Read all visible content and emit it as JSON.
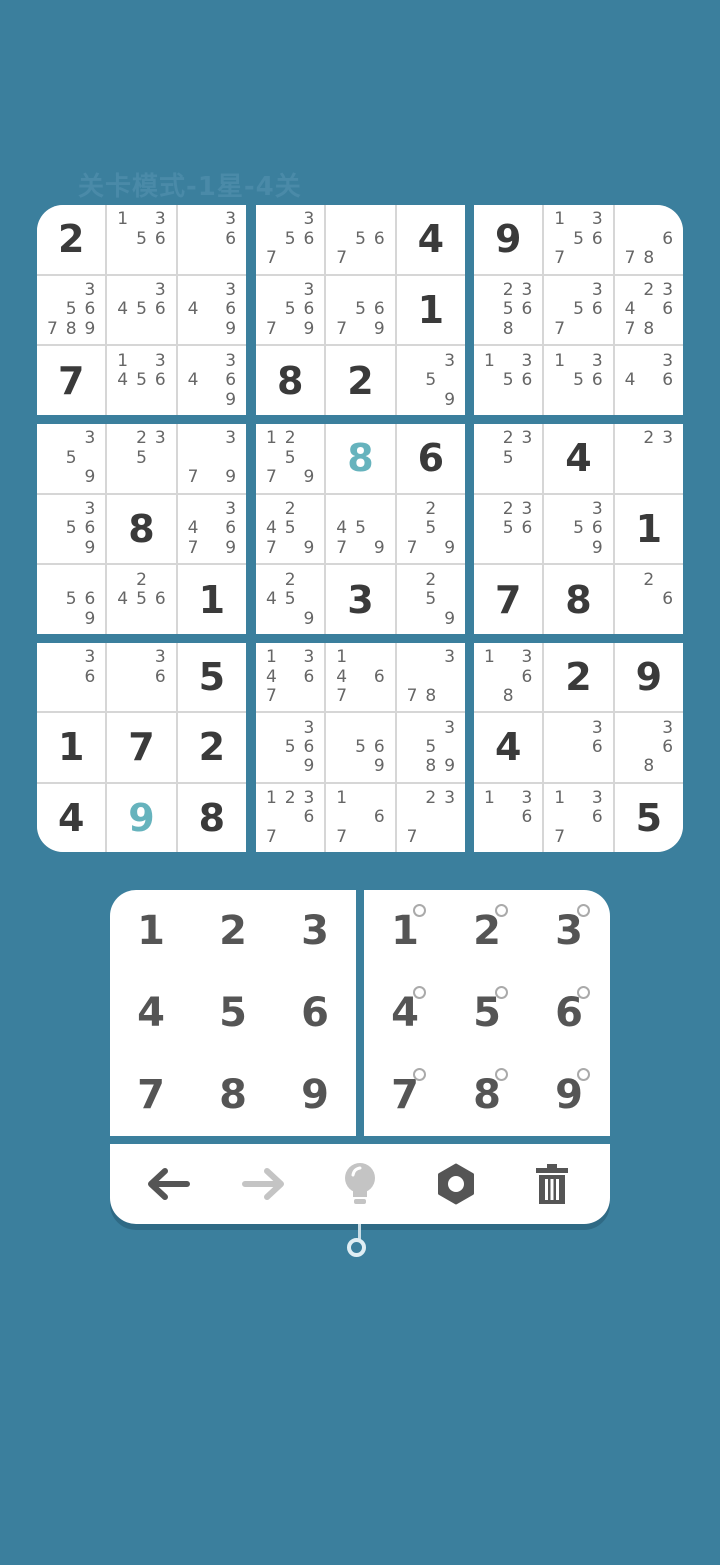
{
  "title": "关卡模式-1星-4关",
  "board": {
    "boxes": [
      [
        {
          "v": "2"
        },
        {
          "n": "1,3,5,6"
        },
        {
          "n": "3,6"
        },
        {
          "n": "3,5,6,7,8,9"
        },
        {
          "n": "3,4,5,6"
        },
        {
          "n": "3,4,6,9"
        },
        {
          "v": "7"
        },
        {
          "n": "1,3,4,5,6"
        },
        {
          "n": "3,4,6,9"
        }
      ],
      [
        {
          "n": "3,5,6,7"
        },
        {
          "n": "5,6,7"
        },
        {
          "v": "4"
        },
        {
          "n": "3,5,6,7,9"
        },
        {
          "n": "5,6,7,9"
        },
        {
          "v": "1"
        },
        {
          "v": "8"
        },
        {
          "v": "2"
        },
        {
          "n": "3,5,9"
        }
      ],
      [
        {
          "v": "9"
        },
        {
          "n": "1,3,5,6,7"
        },
        {
          "n": "6,7,8"
        },
        {
          "n": "2,3,5,6,8"
        },
        {
          "n": "3,5,6,7"
        },
        {
          "n": "2,3,4,6,7,8"
        },
        {
          "n": "1,3,5,6"
        },
        {
          "n": "1,3,5,6"
        },
        {
          "n": "3,4,6"
        }
      ],
      [
        {
          "n": "3,5,9"
        },
        {
          "n": "2,3,5"
        },
        {
          "n": "3,7,9"
        },
        {
          "n": "3,5,6,9"
        },
        {
          "v": "8"
        },
        {
          "n": "3,4,6,7,9"
        },
        {
          "n": "5,6,9"
        },
        {
          "n": "2,4,5,6"
        },
        {
          "v": "1"
        }
      ],
      [
        {
          "n": "1,2,5,7,9"
        },
        {
          "v": "8",
          "hint": true
        },
        {
          "v": "6"
        },
        {
          "n": "2,4,5,7,9"
        },
        {
          "n": "4,5,7,9"
        },
        {
          "n": "2,5,7,9"
        },
        {
          "n": "2,4,5,9"
        },
        {
          "v": "3"
        },
        {
          "n": "2,5,9"
        }
      ],
      [
        {
          "n": "2,3,5"
        },
        {
          "v": "4"
        },
        {
          "n": "2,3"
        },
        {
          "n": "2,3,5,6"
        },
        {
          "n": "3,5,6,9"
        },
        {
          "v": "1"
        },
        {
          "v": "7"
        },
        {
          "v": "8"
        },
        {
          "n": "2,6"
        }
      ],
      [
        {
          "n": "3,6"
        },
        {
          "n": "3,6"
        },
        {
          "v": "5"
        },
        {
          "v": "1"
        },
        {
          "v": "7"
        },
        {
          "v": "2"
        },
        {
          "v": "4"
        },
        {
          "v": "9",
          "hint": true
        },
        {
          "v": "8"
        }
      ],
      [
        {
          "n": "1,3,4,6,7"
        },
        {
          "n": "1,4,6,7"
        },
        {
          "n": "3,7,8"
        },
        {
          "n": "3,5,6,9"
        },
        {
          "n": "5,6,9"
        },
        {
          "n": "3,5,8,9"
        },
        {
          "n": "1,2,3,6,7"
        },
        {
          "n": "1,6,7"
        },
        {
          "n": "2,3,7"
        }
      ],
      [
        {
          "n": "1,3,6,8"
        },
        {
          "v": "2"
        },
        {
          "v": "9"
        },
        {
          "v": "4"
        },
        {
          "n": "3,6"
        },
        {
          "n": "3,6,8"
        },
        {
          "n": "1,3,6"
        },
        {
          "n": "1,3,6,7"
        },
        {
          "v": "5"
        }
      ]
    ]
  },
  "number_pad": [
    "1",
    "2",
    "3",
    "4",
    "5",
    "6",
    "7",
    "8",
    "9"
  ],
  "note_pad": [
    "1",
    "2",
    "3",
    "4",
    "5",
    "6",
    "7",
    "8",
    "9"
  ],
  "toolbar": {
    "undo_icon": "arrow-left-icon",
    "redo_icon": "arrow-right-icon",
    "hint_icon": "lightbulb-icon",
    "settings_icon": "gear-icon",
    "clear_icon": "trash-icon",
    "active_color": "#555555",
    "disabled_color": "#c4c4c4"
  },
  "colors": {
    "background": "#3b7f9d",
    "given_digit": "#3a3a3a",
    "hint_digit": "#66b3bd",
    "note_digit": "#666666"
  }
}
